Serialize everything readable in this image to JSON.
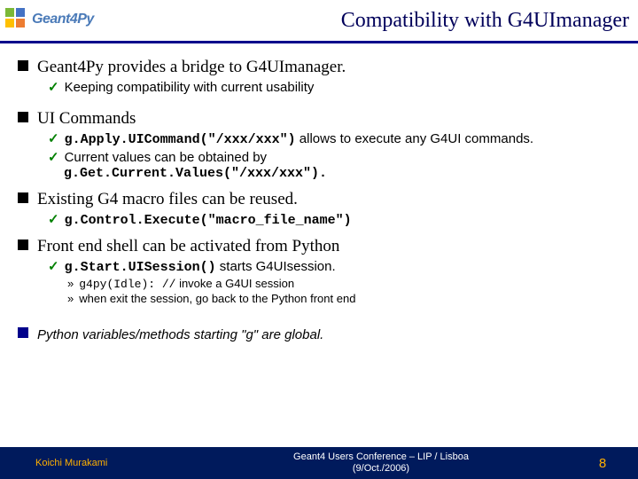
{
  "header": {
    "logo_text": "Geant4Py",
    "title": "Compatibility with G4UImanager"
  },
  "bullets": [
    {
      "text": "Geant4Py provides a bridge to G4UImanager.",
      "subs": [
        {
          "type": "check",
          "text": "Keeping compatibility with current usability"
        }
      ]
    },
    {
      "text": "UI Commands",
      "subs": [
        {
          "type": "check",
          "code": "g.Apply.UICommand(\"/xxx/xxx\")",
          "after": " allows to execute any G4UI commands."
        },
        {
          "type": "check",
          "text": "Current values can be obtained by ",
          "code_after": "g.Get.Current.Values(\"/xxx/xxx\")."
        }
      ]
    },
    {
      "text": "Existing G4 macro files can be reused.",
      "subs": [
        {
          "type": "check",
          "code": "g.Control.Execute(\"macro_file_name\")"
        }
      ]
    },
    {
      "text": "Front end shell can be activated from Python",
      "subs": [
        {
          "type": "check",
          "code": "g.Start.UISession()",
          "after": " starts G4UIsession."
        }
      ],
      "subsubs": [
        {
          "code": "g4py(Idle): //",
          "after": " invoke a G4UI session"
        },
        {
          "text": "when exit the session, go back to the Python front end"
        }
      ]
    }
  ],
  "note": {
    "prefix": "Python variables/methods starting \"g\" are global."
  },
  "footer": {
    "author": "Koichi Murakami",
    "center_line1": "Geant4 Users Conference – LIP / Lisboa",
    "center_line2": "(9/Oct./2006)",
    "page": "8"
  }
}
